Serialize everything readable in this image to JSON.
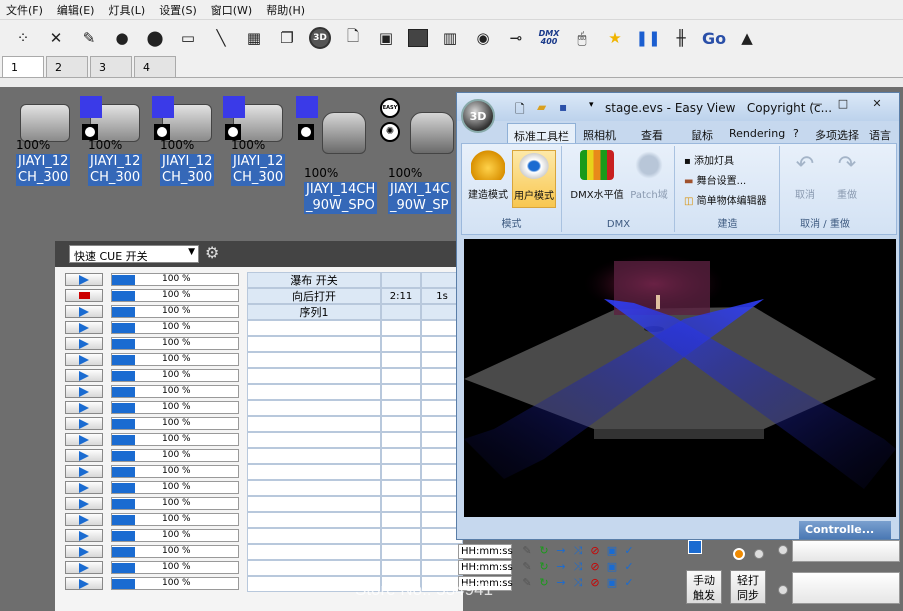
{
  "menubar": [
    "文件(F)",
    "编辑(E)",
    "灯具(L)",
    "设置(S)",
    "窗口(W)",
    "帮助(H)"
  ],
  "toolbar": {
    "dmx_label": "DMX 400",
    "go_label": "Go",
    "threed_label": "3D"
  },
  "tabs": [
    "1",
    "2",
    "3",
    "4"
  ],
  "fixtures": [
    {
      "pct": "100%",
      "name1": "JIAYI_12",
      "name2": "CH_300"
    },
    {
      "pct": "100%",
      "name1": "JIAYI_12",
      "name2": "CH_300"
    },
    {
      "pct": "100%",
      "name1": "JIAYI_12",
      "name2": "CH_300"
    },
    {
      "pct": "100%",
      "name1": "JIAYI_12",
      "name2": "CH_300"
    },
    {
      "pct": "100%",
      "name1": "JIAYI_14CH",
      "name2": "_90W_SPO"
    },
    {
      "pct": "100%",
      "name1": "JIAYI_14C",
      "name2": "_90W_SP"
    }
  ],
  "fixture_badge": "EASY",
  "cue": {
    "select_value": "快速 CUE 开关",
    "rows": [
      {
        "pct": "100 %",
        "name": "瀑布 开关",
        "c2": "",
        "c3": "",
        "state": "play"
      },
      {
        "pct": "100 %",
        "name": "向后打开",
        "c2": "2:11",
        "c3": "1s",
        "state": "stop"
      },
      {
        "pct": "100 %",
        "name": "序列1",
        "c2": "",
        "c3": "",
        "state": "play"
      },
      {
        "pct": "100 %",
        "name": "",
        "c2": "",
        "c3": "",
        "state": "play"
      },
      {
        "pct": "100 %",
        "name": "",
        "c2": "",
        "c3": "",
        "state": "play"
      },
      {
        "pct": "100 %",
        "name": "",
        "c2": "",
        "c3": "",
        "state": "play"
      },
      {
        "pct": "100 %",
        "name": "",
        "c2": "",
        "c3": "",
        "state": "play"
      },
      {
        "pct": "100 %",
        "name": "",
        "c2": "",
        "c3": "",
        "state": "play"
      },
      {
        "pct": "100 %",
        "name": "",
        "c2": "",
        "c3": "",
        "state": "play"
      },
      {
        "pct": "100 %",
        "name": "",
        "c2": "",
        "c3": "",
        "state": "play"
      },
      {
        "pct": "100 %",
        "name": "",
        "c2": "",
        "c3": "",
        "state": "play"
      },
      {
        "pct": "100 %",
        "name": "",
        "c2": "",
        "c3": "",
        "state": "play"
      },
      {
        "pct": "100 %",
        "name": "",
        "c2": "",
        "c3": "",
        "state": "play"
      },
      {
        "pct": "100 %",
        "name": "",
        "c2": "",
        "c3": "",
        "state": "play"
      },
      {
        "pct": "100 %",
        "name": "",
        "c2": "",
        "c3": "",
        "state": "play"
      },
      {
        "pct": "100 %",
        "name": "",
        "c2": "",
        "c3": "",
        "state": "play"
      },
      {
        "pct": "100 %",
        "name": "",
        "c2": "",
        "c3": "",
        "state": "play"
      },
      {
        "pct": "100 %",
        "name": "",
        "c2": "",
        "c3": "",
        "state": "play"
      },
      {
        "pct": "100 %",
        "name": "",
        "c2": "",
        "c3": "",
        "state": "play"
      },
      {
        "pct": "100 %",
        "name": "",
        "c2": "",
        "c3": "",
        "state": "play"
      }
    ],
    "fill_pct": 18
  },
  "time_fields": [
    "HH:mm:ss",
    "HH:mm:ss",
    "HH:mm:ss"
  ],
  "buttons": {
    "manual_trigger": [
      "手动",
      "触发"
    ],
    "tap_sync": [
      "轻打",
      "同步"
    ]
  },
  "window": {
    "title": "stage.evs - Easy View",
    "copyright": "Copyright (c...",
    "orb_label": "3D",
    "ribbon_tabs": [
      "标准工具栏",
      "照相机",
      "查看",
      "鼠标",
      "Rendering",
      "?",
      "多项选择",
      "语言"
    ],
    "mode_group": {
      "label": "模式",
      "build": "建造模式",
      "user": "用户模式"
    },
    "dmx_group": {
      "label": "DMX",
      "level": "DMX水平值",
      "patch": "Patch域"
    },
    "build_group": {
      "label": "建造",
      "add": "添加灯具",
      "stage": "舞台设置...",
      "editor": "简单物体编辑器"
    },
    "undo_group": {
      "label": "取消 / 重做",
      "undo": "取消",
      "redo": "重做"
    },
    "status": "Controlle..."
  },
  "watermark": "Store No.: 534941",
  "colors": {
    "selection": "#3568b8",
    "accent_blue": "#1a6bd1",
    "ribbon": "#d3e2f4",
    "stop_red": "#cc0000"
  }
}
